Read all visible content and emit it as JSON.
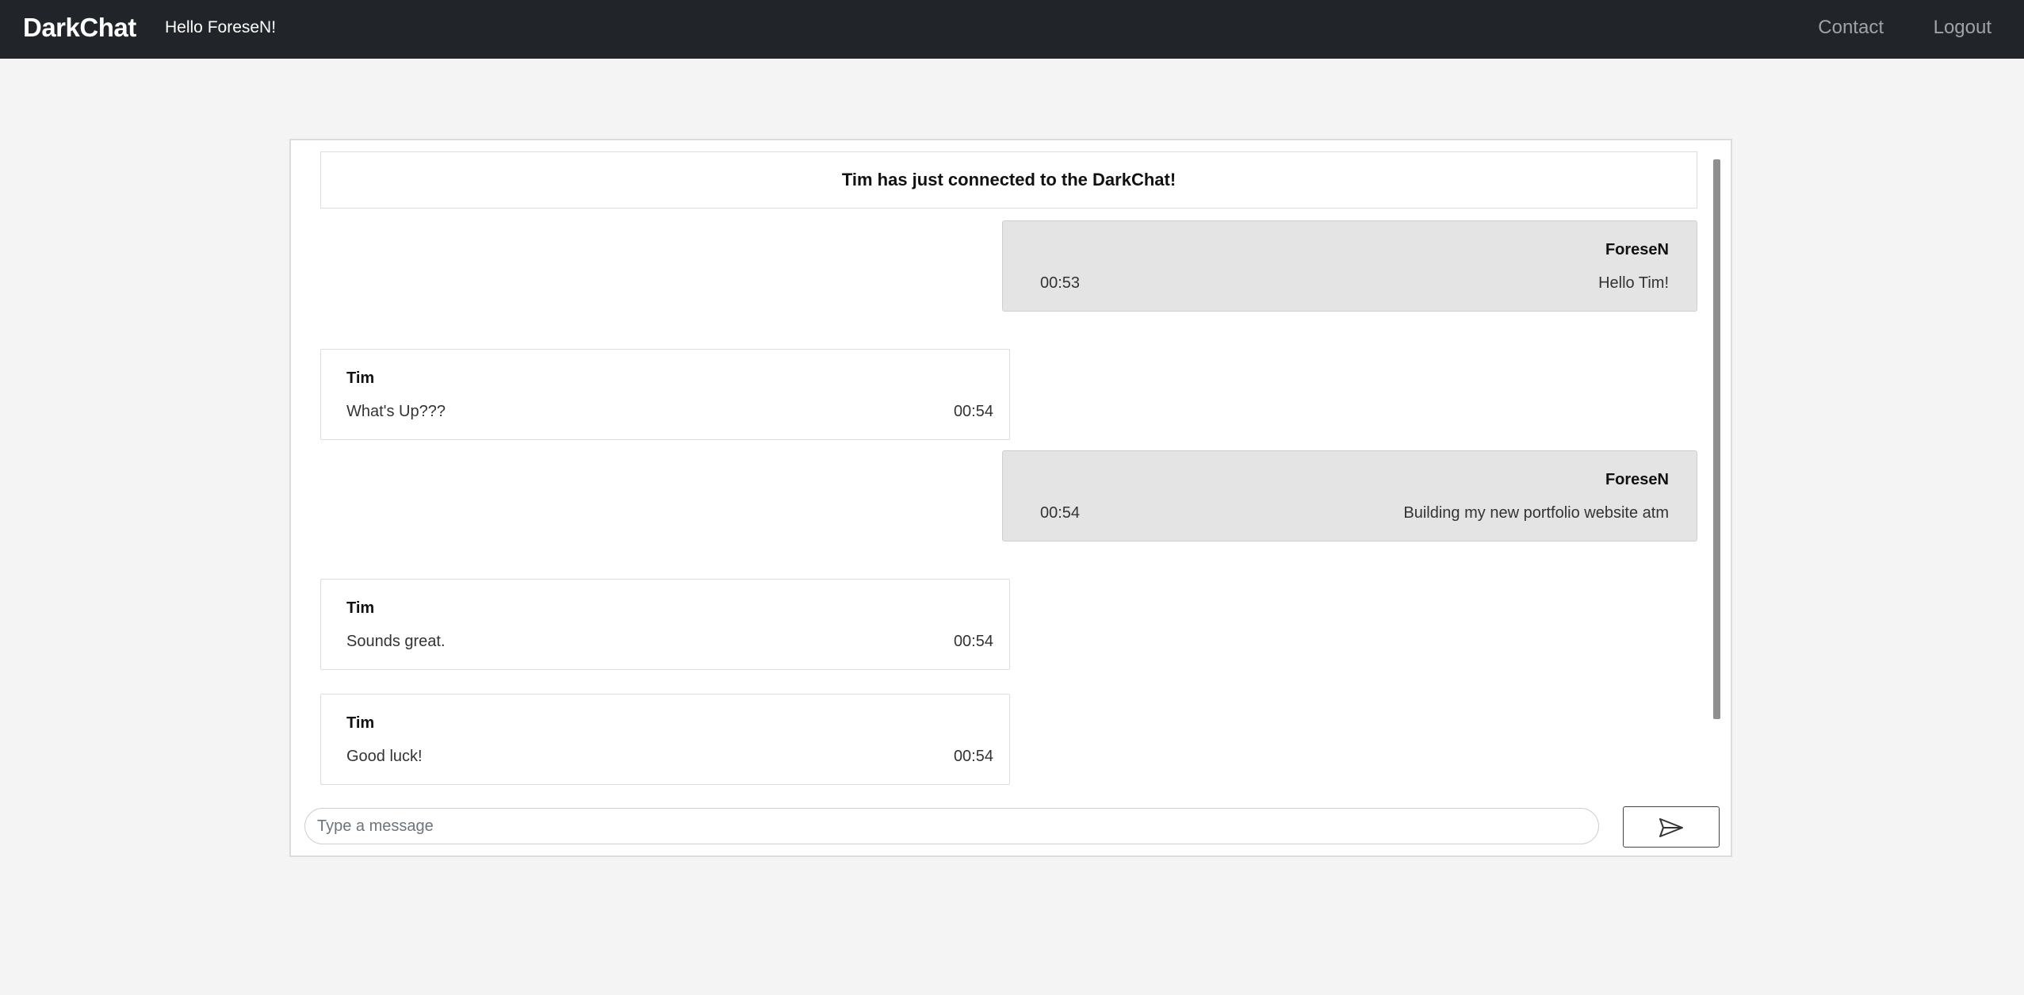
{
  "navbar": {
    "brand": "DarkChat",
    "greeting": "Hello ForeseN!",
    "links": {
      "contact": "Contact",
      "logout": "Logout"
    }
  },
  "chat": {
    "system_message": "Tim has just connected to the DarkChat!",
    "messages": [
      {
        "author": "ForeseN",
        "text": "Hello Tim!",
        "time": "00:53",
        "own": true
      },
      {
        "author": "Tim",
        "text": "What's Up???",
        "time": "00:54",
        "own": false
      },
      {
        "author": "ForeseN",
        "text": "Building my new portfolio website atm",
        "time": "00:54",
        "own": true
      },
      {
        "author": "Tim",
        "text": "Sounds great.",
        "time": "00:54",
        "own": false
      },
      {
        "author": "Tim",
        "text": "Good luck!",
        "time": "00:54",
        "own": false
      }
    ],
    "input": {
      "placeholder": "Type a message",
      "value": ""
    },
    "send_icon": "send-icon"
  },
  "colors": {
    "navbar_bg": "#212529",
    "page_bg": "#f4f4f4",
    "own_bubble_bg": "#e4e4e4",
    "other_bubble_bg": "#ffffff"
  }
}
